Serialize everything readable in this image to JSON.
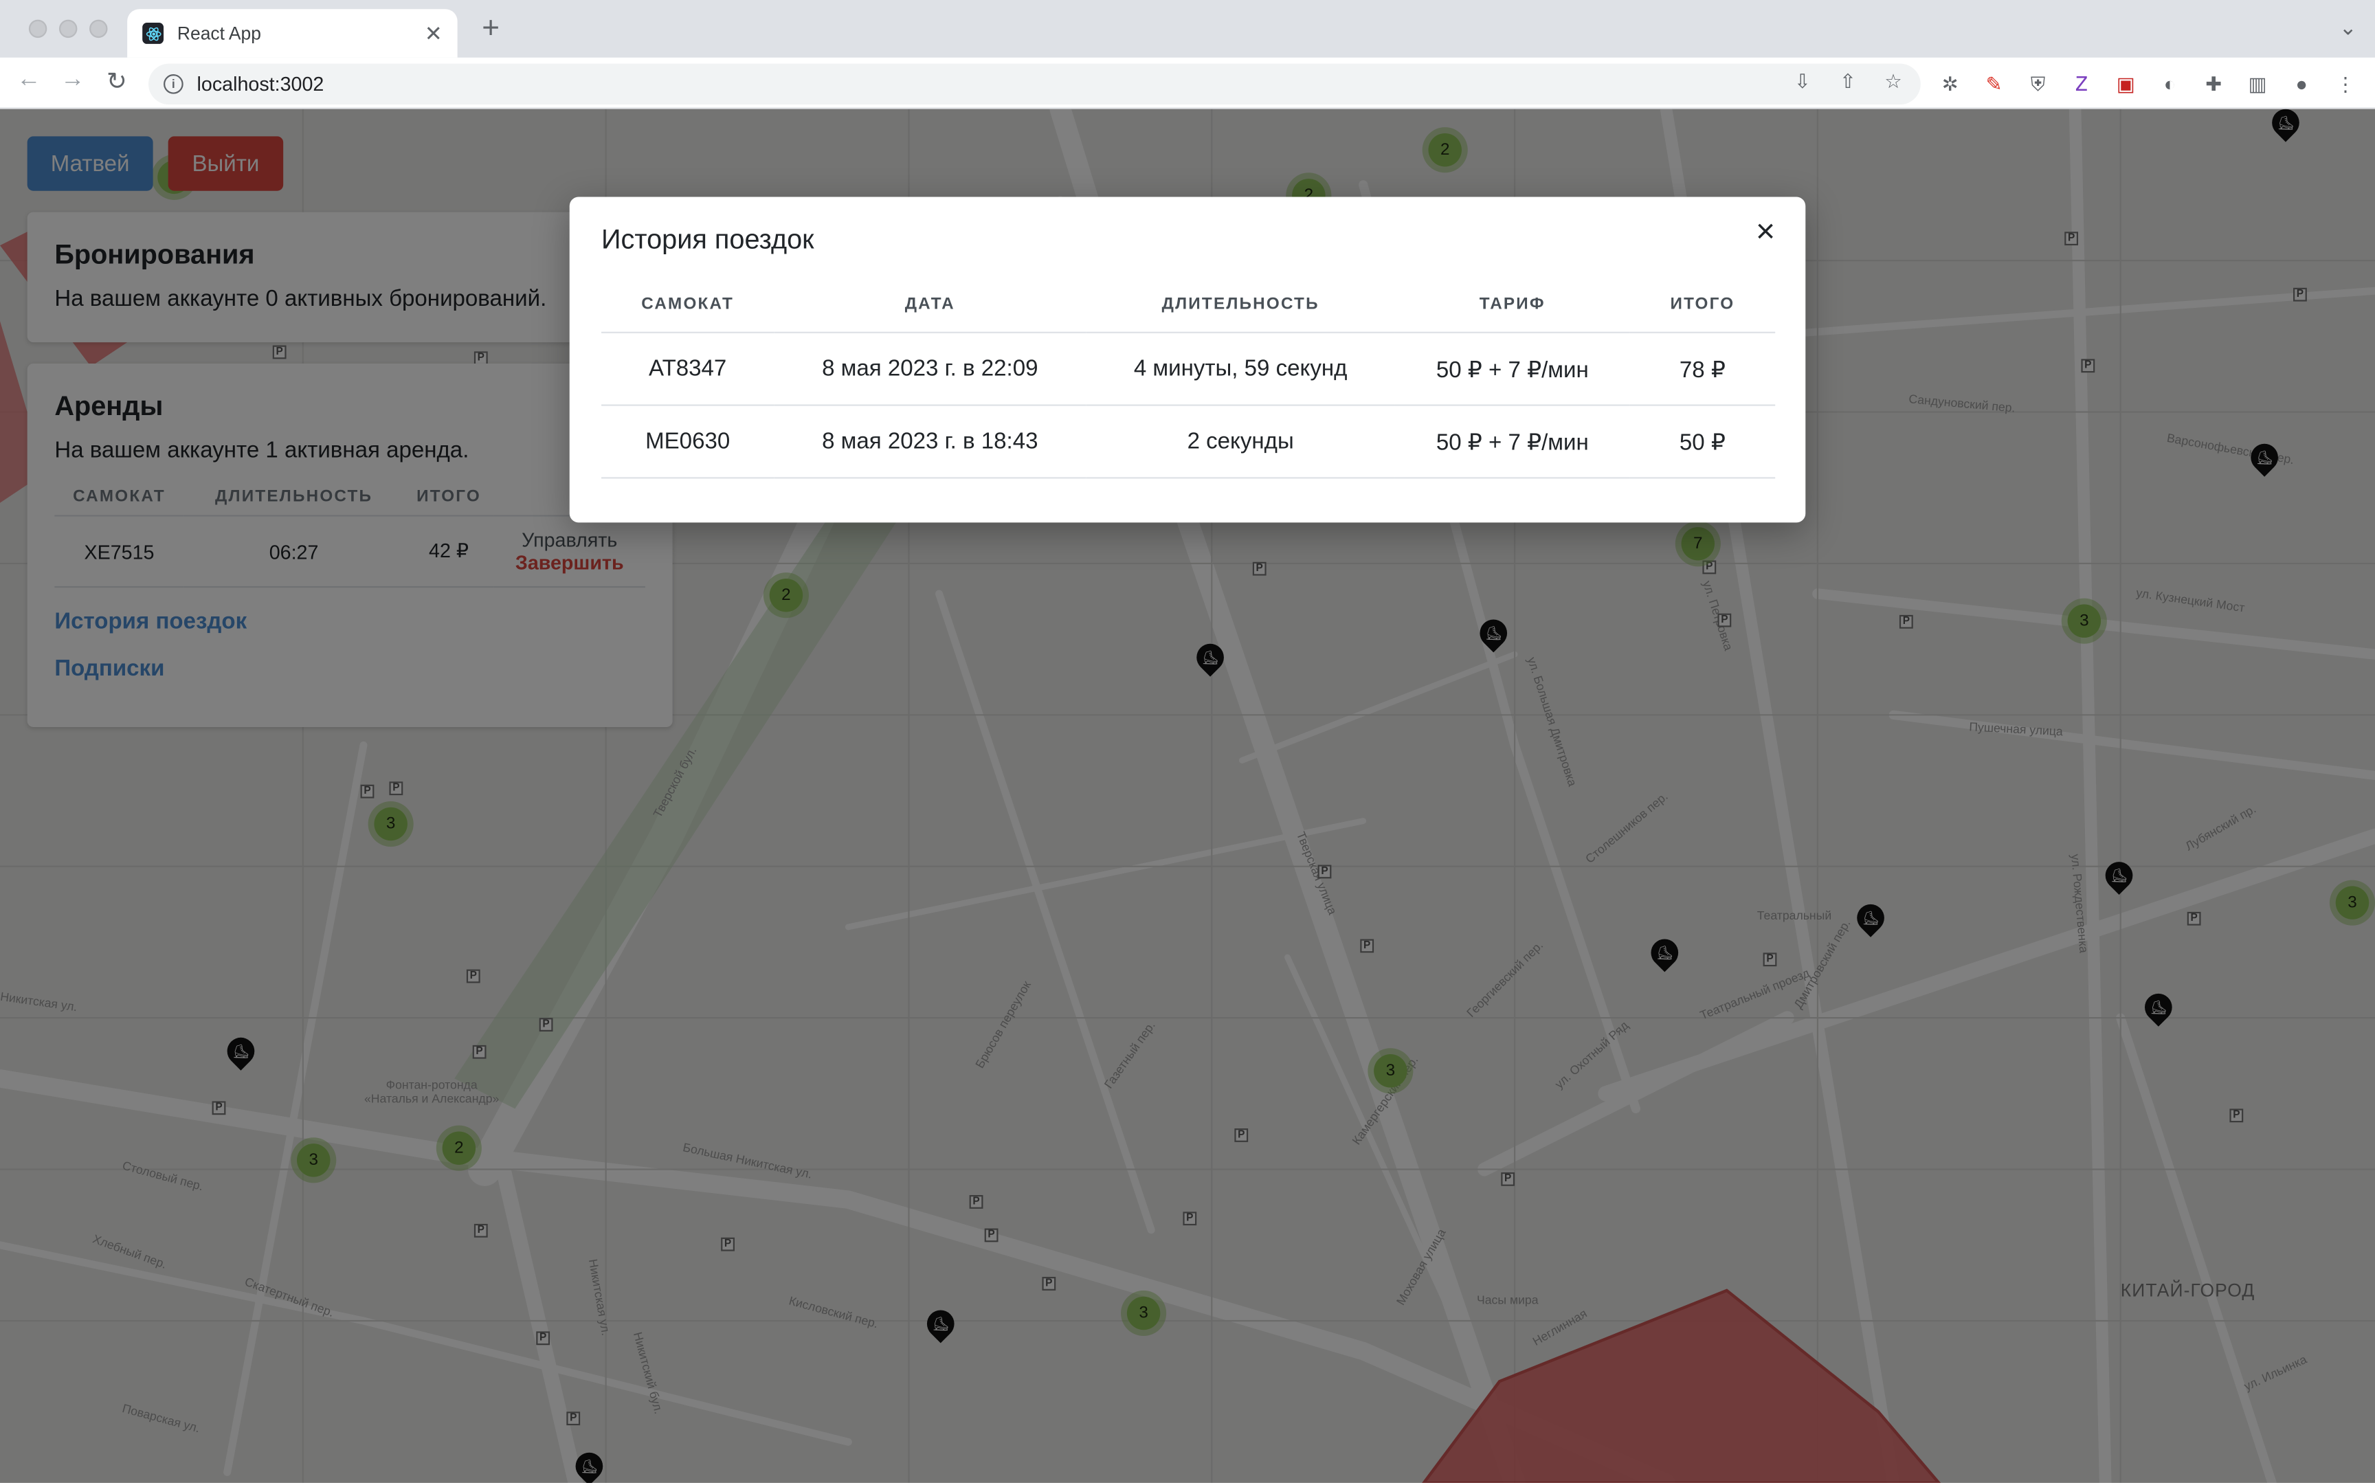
{
  "browser": {
    "tab_title": "React App",
    "url": "localhost:3002",
    "new_tab_label": "+",
    "tab_close_label": "✕"
  },
  "header": {
    "user_button": "Матвей",
    "logout_button": "Выйти"
  },
  "bookings": {
    "title": "Бронирования",
    "text": "На вашем аккаунте 0 активных бронирований."
  },
  "rentals": {
    "title": "Аренды",
    "text": "На вашем аккаунте 1 активная аренда.",
    "columns": [
      "САМОКАТ",
      "ДЛИТЕЛЬНОСТЬ",
      "ИТОГО",
      ""
    ],
    "rows": [
      {
        "scooter": "XE7515",
        "duration": "06:27",
        "total": "42 ₽",
        "manage": "Управлять",
        "finish": "Завершить"
      }
    ],
    "history_link": "История поездок",
    "subscriptions_link": "Подписки"
  },
  "history_modal": {
    "title": "История поездок",
    "close_label": "×",
    "columns": [
      "САМОКАТ",
      "ДАТА",
      "ДЛИТЕЛЬНОСТЬ",
      "ТАРИФ",
      "ИТОГО"
    ],
    "rows": [
      {
        "scooter": "AT8347",
        "date": "8 мая 2023 г. в 22:09",
        "duration": "4 минуты, 59 секунд",
        "tariff": "50 ₽ + 7 ₽/мин",
        "total": "78 ₽"
      },
      {
        "scooter": "ME0630",
        "date": "8 мая 2023 г. в 18:43",
        "duration": "2 секунды",
        "tariff": "50 ₽ + 7 ₽/мин",
        "total": "50 ₽"
      }
    ]
  },
  "map": {
    "clusters": [
      "2",
      "2",
      "2",
      "7",
      "3",
      "3",
      "3",
      "3",
      "2",
      "3",
      "3",
      "3"
    ],
    "streets": [
      "Тверская улица",
      "Большая Никитская ул.",
      "Тверской бул.",
      "Никитская ул.",
      "ул. Охотный Ряд",
      "Театральный проезд",
      "Моховая улица",
      "Неглинная",
      "Пушечная улица",
      "Лубянский пр.",
      "Никитский бул.",
      "Столовый пер.",
      "Скатертный пер.",
      "Хлебный пер.",
      "Газетный пер.",
      "Кисловский пер.",
      "Брюсов переулок",
      "Георгиевский пер.",
      "Камергерский пер.",
      "Столешников пер.",
      "Дмитровский пер.",
      "ул. Петровка",
      "ул. Рождественка",
      "ул. Кузнецкий Мост",
      "Театральный",
      "ул. Ильинка",
      "Варсонофьевский пер.",
      "Сандуновский пер.",
      "Фонтан-ротонда «Наталья и Александр»",
      "Часы мира",
      "ул. Большая Дмитровка",
      "Никитская ул.",
      "Поварская ул."
    ],
    "district": "КИТАЙ-ГОРОД",
    "accent_cluster": "#8fc05a",
    "zone_color": "#e06b6b"
  }
}
